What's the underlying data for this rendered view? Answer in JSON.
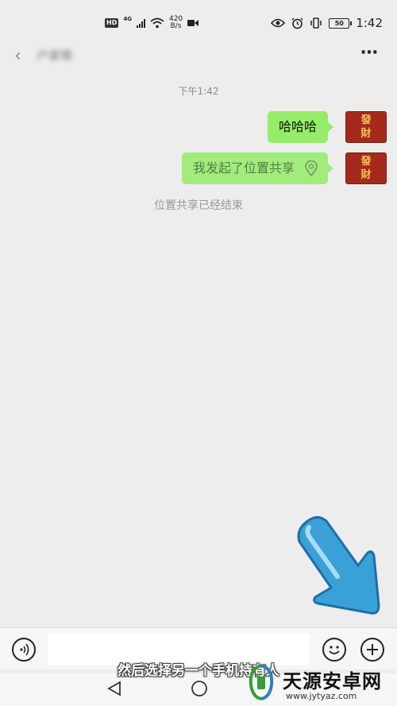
{
  "status_bar": {
    "hd": "HD",
    "network": "4G",
    "speed_value": "420",
    "speed_unit": "B/s",
    "battery": "50",
    "time": "1:42"
  },
  "header": {
    "contact_name": "户家嗯"
  },
  "chat": {
    "timestamp": "下午1:42",
    "messages": [
      {
        "text": "哈哈哈",
        "avatar_top": "發",
        "avatar_bottom": "財"
      },
      {
        "text": "我发起了位置共享",
        "avatar_top": "發",
        "avatar_bottom": "財"
      }
    ],
    "system_message": "位置共享已经结束"
  },
  "subtitle": "然后选择另一个手机持有人",
  "watermark": {
    "name": "天源安卓网",
    "url": "www.jytyaz.com"
  },
  "colors": {
    "bubble": "#95ec69",
    "background": "#ededed",
    "avatar": "#a52a1c",
    "arrow": "#3aa0d8"
  }
}
